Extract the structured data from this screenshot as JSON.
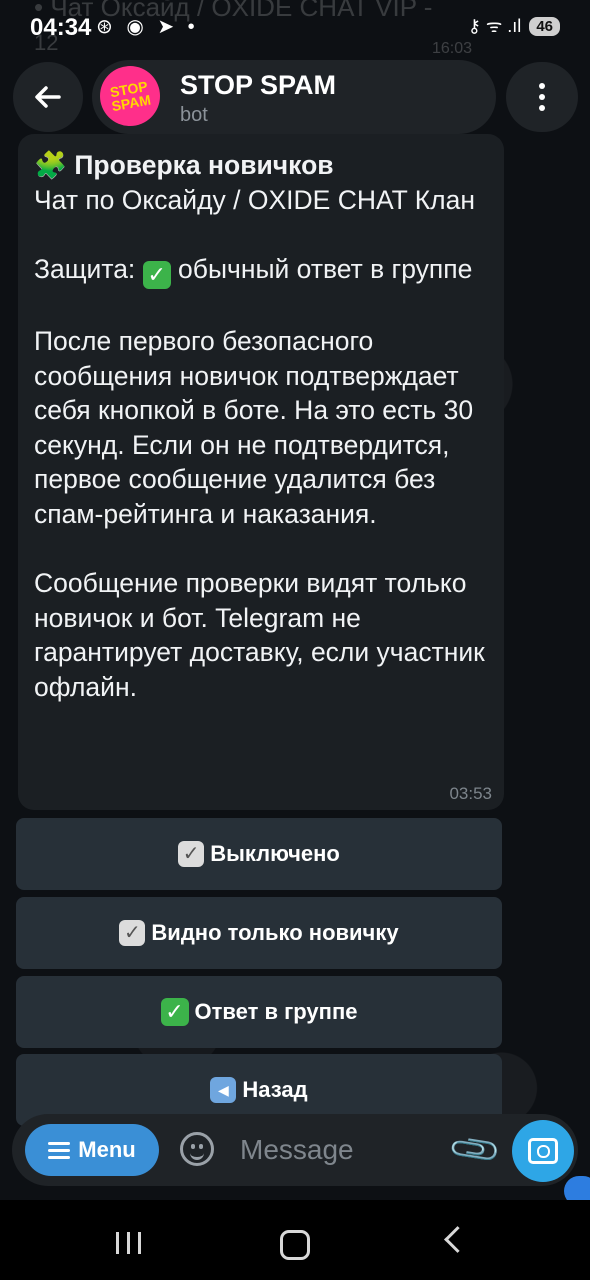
{
  "status_bar": {
    "time": "04:34",
    "left_icons": "⊛ ◉ ➤ •",
    "right_icons": "⚷ ᯤ .ıl",
    "battery": "46"
  },
  "background_ghost": {
    "chat_title": "• Чат Оксайд / OXIDE CHAT VIP -",
    "number": "12",
    "time": "16:03"
  },
  "header": {
    "title": "STOP SPAM",
    "subtitle": "bot",
    "avatar_text": "STOP SPAM"
  },
  "message": {
    "heading": "Проверка новичков",
    "chat_line": "Чат по Оксайду / OXIDE CHAT Клан",
    "protection_prefix": "Защита:",
    "protection_value": "обычный ответ в группе",
    "paragraph1": "После первого безопасного сообщения новичок подтверждает себя кнопкой в боте. На это есть 30 секунд. Если он не подтвердится, первое сообщение удалится без спам-рейтинга и наказания.",
    "paragraph2": "Сообщение проверки видят только новичок и бот. Telegram не гарантирует доставку, если участник офлайн.",
    "time": "03:53"
  },
  "keyboard": {
    "btn_off": "Выключено",
    "btn_newcomer_only": "Видно только новичку",
    "btn_group_reply": "Ответ в группе",
    "btn_back": "Назад"
  },
  "composer": {
    "menu_label": "Menu",
    "placeholder": "Message"
  },
  "icons": {
    "back": "arrow-left-icon",
    "more": "more-vertical-icon",
    "puzzle": "puzzle-icon",
    "check_green": "check-box-green-icon",
    "check_grey": "check-box-grey-icon",
    "back_arrow": "back-arrow-box-icon",
    "emoji": "emoji-icon",
    "attach": "paperclip-icon",
    "camera": "camera-icon"
  },
  "colors": {
    "accent": "#3a8fd6",
    "bubble": "#1b1f23",
    "button": "#273038",
    "check_green": "#3cb34a"
  }
}
